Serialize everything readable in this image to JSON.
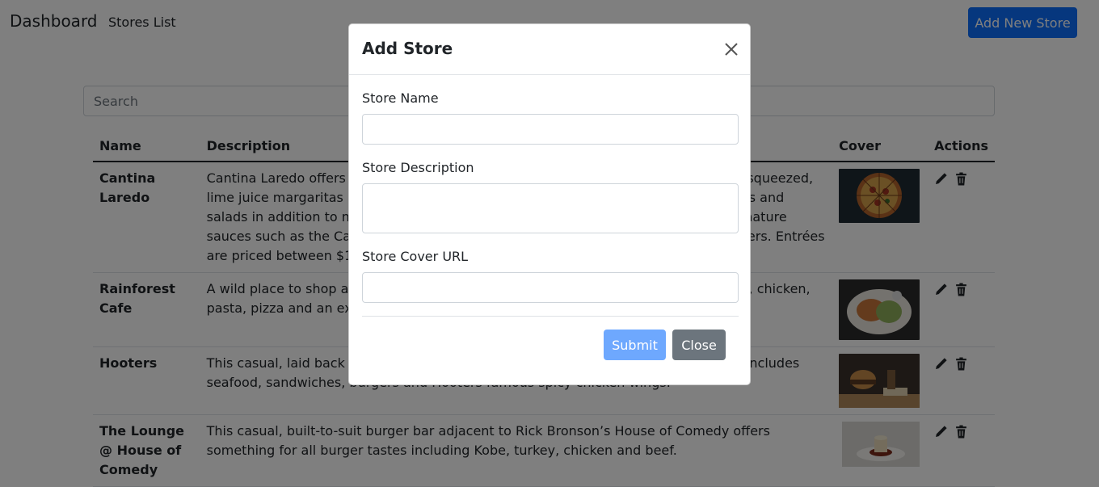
{
  "navbar": {
    "brand": "Dashboard",
    "stores_link": "Stores List",
    "add_button": "Add New Store"
  },
  "search": {
    "placeholder": "Search"
  },
  "table": {
    "headers": [
      "Name",
      "Description",
      "Cover",
      "Actions"
    ],
    "rows": [
      {
        "name": "Cantina Laredo",
        "description": "Cantina Laredo offers a modern take on authentic Mexican cuisine, signature hand-squeezed, lime juice margaritas and fresh guacamole. The menu features grilled dishes, pastas and salads in addition to many choice plates. Be sure to try one of Cantina Laredo’s signature sauces such as the Cantina Laredo’s Chipotle Ranch and one of their delicious starters. Entrées are priced between $14",
        "cover": "pizza"
      },
      {
        "name": "Rainforest Cafe",
        "description": "A wild place to shop and eat, Rainforest Cafe features a varied menu including beef, chicken, pasta, pizza and an exciting array of other dishes.",
        "cover": "salad"
      },
      {
        "name": "Hooters",
        "description": "This casual, laid back restaurant is known for its friendly service and its menu that includes seafood, sandwiches, burgers and Hooters famous spicy chicken wings.",
        "cover": "burger"
      },
      {
        "name": "The Lounge @ House of Comedy",
        "description": "This casual, built-to-suit burger bar adjacent to Rick Bronson’s House of Comedy offers something for all burger tastes including Kobe, turkey, chicken and beef.",
        "cover": "dessert"
      }
    ]
  },
  "modal": {
    "title": "Add Store",
    "name_label": "Store Name",
    "name_value": "",
    "description_label": "Store Description",
    "description_value": "",
    "cover_label": "Store Cover URL",
    "cover_value": "",
    "submit_label": "Submit",
    "close_label": "Close"
  },
  "colors": {
    "primary": "#0d6efd",
    "primary_disabled": "#6ea8fe",
    "secondary": "#6c757d",
    "backdrop": "rgba(0,0,0,0.5)"
  }
}
